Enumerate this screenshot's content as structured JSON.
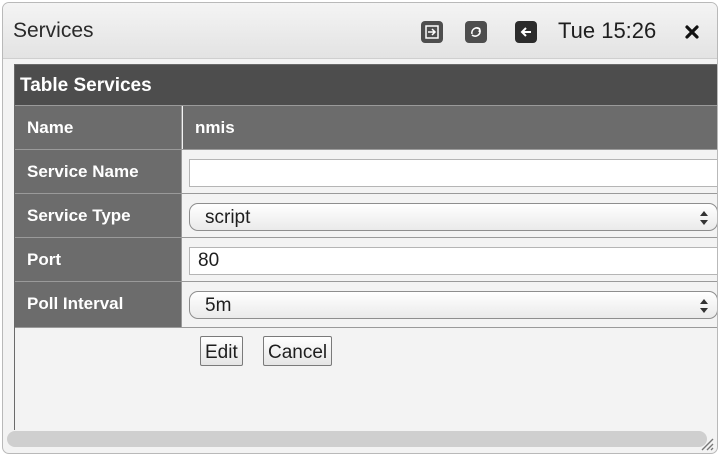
{
  "window": {
    "title": "Services",
    "clock": "Tue 15:26",
    "icons": [
      "export-icon",
      "refresh-icon",
      "back-arrow-icon",
      "close-icon"
    ]
  },
  "table": {
    "title": "Table Services",
    "header": {
      "label": "Name",
      "value": "nmis"
    },
    "rows": [
      {
        "label": "Service Name",
        "type": "text",
        "value": ""
      },
      {
        "label": "Service Type",
        "type": "select",
        "value": "script"
      },
      {
        "label": "Port",
        "type": "text",
        "value": "80"
      },
      {
        "label": "Poll Interval",
        "type": "select",
        "value": "5m"
      }
    ],
    "buttons": {
      "edit": "Edit",
      "cancel": "Cancel"
    }
  },
  "colors": {
    "header_bg": "#4d4d4d",
    "label_bg": "#6c6c6c",
    "panel_bg": "#f3f3f3"
  }
}
